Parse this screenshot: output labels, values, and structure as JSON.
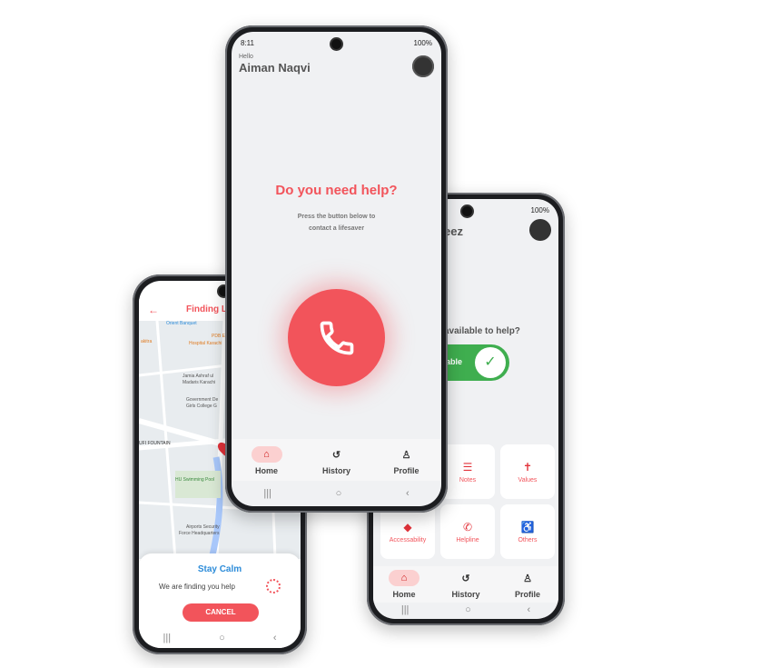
{
  "colors": {
    "accent": "#f2545b",
    "green": "#3fae4f",
    "link_blue": "#2d8cd9"
  },
  "main_phone": {
    "status_time": "8:11",
    "status_right": "100%",
    "greeting": "Hello",
    "user_name": "Aiman Naqvi",
    "question": "Do you need help?",
    "instruction_line1": "Press the button below to",
    "instruction_line2": "contact a lifesaver",
    "nav": [
      {
        "label": "Home",
        "icon": "home-icon"
      },
      {
        "label": "History",
        "icon": "history-icon"
      },
      {
        "label": "Profile",
        "icon": "profile-icon"
      }
    ]
  },
  "right_phone": {
    "status_right": "100%",
    "name_partial": "eez",
    "question_partial": "available to help?",
    "toggle_label_partial": "able",
    "cards": [
      {
        "label": "Notes",
        "icon": "notes-icon"
      },
      {
        "label": "Values",
        "icon": "values-icon"
      },
      {
        "label": "Accessability",
        "icon": "accessibility-icon"
      },
      {
        "label": "Helpline",
        "icon": "phone-icon"
      },
      {
        "label": "Others",
        "icon": "wheelchair-icon"
      }
    ],
    "nav": [
      {
        "label": "Home",
        "icon": "home-icon"
      },
      {
        "label": "History",
        "icon": "history-icon"
      },
      {
        "label": "Profile",
        "icon": "profile-icon"
      }
    ]
  },
  "left_phone": {
    "title_partial": "Finding Li",
    "map_labels": [
      "Orient Banquet",
      "PDB Eye",
      "Hospital Karachi",
      "Jamia Ashraf ul",
      "Madaris Karachi",
      "Government De",
      "Girls College G",
      "HU Swimming Pool",
      "Airports Security",
      "Force Headquarters",
      "UFI FOUNTAIN",
      "akitra"
    ],
    "sheet_title": "Stay Calm",
    "sheet_message": "We are finding you help",
    "cancel_label": "CANCEL"
  }
}
